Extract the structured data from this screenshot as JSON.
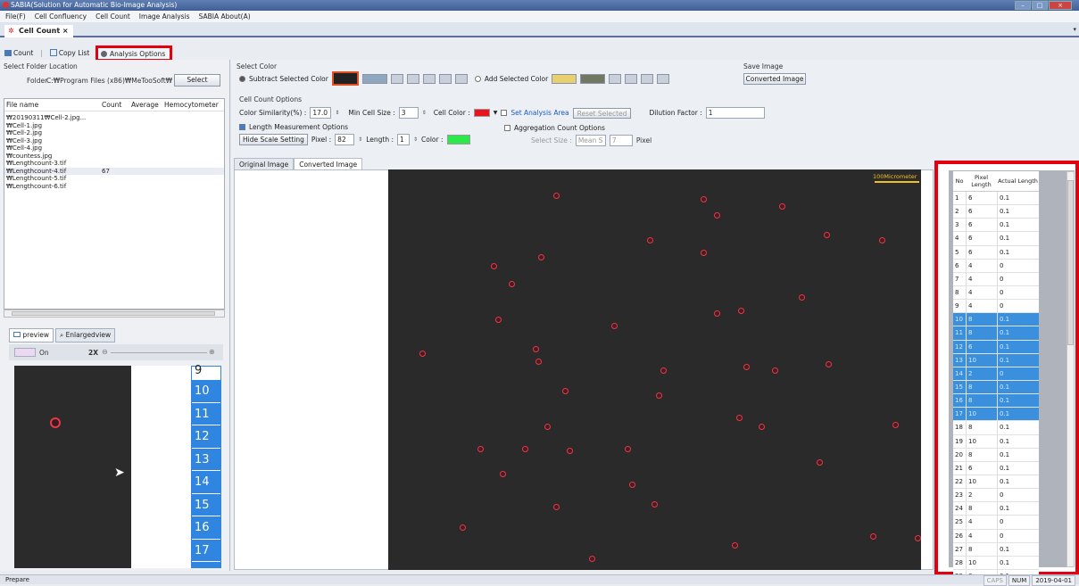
{
  "window": {
    "title": "SABIA(Solution for Automatic Bio-Image Analysis)"
  },
  "menu": [
    "File(F)",
    "Cell Confluency",
    "Cell Count",
    "Image Analysis",
    "SABIA About(A)"
  ],
  "doc_tab": "Cell Count ×",
  "toolbar": {
    "count": "Count",
    "copy_list": "Copy List",
    "analysis_options": "Analysis Options"
  },
  "folder": {
    "section": "Select Folder Location",
    "label": "Folder",
    "path": "C:₩Program Files (x86)₩MeTooSoft₩",
    "select": "Select"
  },
  "filelist": {
    "headers": [
      "File name",
      "Count",
      "Average",
      "Hemocytometer"
    ],
    "rows": [
      {
        "name": "₩20190311₩Cell-2.jpg...",
        "count": ""
      },
      {
        "name": "₩Cell-1.jpg",
        "count": ""
      },
      {
        "name": "₩Cell-2.jpg",
        "count": ""
      },
      {
        "name": "₩Cell-3.jpg",
        "count": ""
      },
      {
        "name": "₩Cell-4.jpg",
        "count": ""
      },
      {
        "name": "₩countess.jpg",
        "count": ""
      },
      {
        "name": "₩Lengthcount-3.tif",
        "count": ""
      },
      {
        "name": "₩Lengthcount-4.tif",
        "count": "67"
      },
      {
        "name": "₩Lengthcount-5.tif",
        "count": ""
      },
      {
        "name": "₩Lengthcount-6.tif",
        "count": ""
      }
    ]
  },
  "preview": {
    "tab_preview": "preview",
    "tab_enlarged": "Enlargedview",
    "on": "On",
    "zoom": "2X",
    "numbers": [
      "9",
      "10",
      "11",
      "12",
      "13",
      "14",
      "15",
      "16",
      "17"
    ]
  },
  "select_color": {
    "section": "Select Color",
    "subtract": "Subtract Selected Color",
    "add": "Add Selected Color",
    "save_section": "Save Image",
    "save_button": "Converted Image"
  },
  "cell_count_options": {
    "section": "Cell Count Options",
    "similarity_label": "Color Similarity(%) :",
    "similarity": "17.0",
    "min_size_label": "Min Cell Size :",
    "min_size": "3",
    "cell_color_label": "Cell Color :",
    "set_area": "Set Analysis Area",
    "reset": "Reset Selected",
    "dilution_label": "Dilution Factor :",
    "dilution": "1",
    "length_opts": "Length Measurement Options",
    "hide_scale": "Hide Scale Setting",
    "pixel_label": "Pixel :",
    "pixel": "82",
    "length_label": "Length :",
    "length": "1",
    "color_label": "Color :",
    "aggregation": "Aggregation Count Options",
    "select_size_label": "Select Size :",
    "select_size": "Mean S",
    "select_size_value": "7",
    "pixel_unit": "Pixel"
  },
  "image_tabs": [
    "Original Image",
    "Converted Image"
  ],
  "scale_label": "100Micrometer",
  "colors": {
    "accent_red": "#e3000f",
    "cell_red": "#e23a4a",
    "select_blue": "#3a90dd",
    "length_green": "#2de84a",
    "cell_color": "#e8141e"
  },
  "results": {
    "headers": [
      "No",
      "Pixel Length",
      "Actual Length"
    ],
    "rows": [
      [
        "1",
        "6",
        "0.1"
      ],
      [
        "2",
        "6",
        "0.1"
      ],
      [
        "3",
        "6",
        "0.1"
      ],
      [
        "4",
        "6",
        "0.1"
      ],
      [
        "5",
        "6",
        "0.1"
      ],
      [
        "6",
        "4",
        "0"
      ],
      [
        "7",
        "4",
        "0"
      ],
      [
        "8",
        "4",
        "0"
      ],
      [
        "9",
        "4",
        "0"
      ],
      [
        "10",
        "8",
        "0.1"
      ],
      [
        "11",
        "8",
        "0.1"
      ],
      [
        "12",
        "6",
        "0.1"
      ],
      [
        "13",
        "10",
        "0.1"
      ],
      [
        "14",
        "2",
        "0"
      ],
      [
        "15",
        "8",
        "0.1"
      ],
      [
        "16",
        "8",
        "0.1"
      ],
      [
        "17",
        "10",
        "0.1"
      ],
      [
        "18",
        "8",
        "0.1"
      ],
      [
        "19",
        "10",
        "0.1"
      ],
      [
        "20",
        "8",
        "0.1"
      ],
      [
        "21",
        "6",
        "0.1"
      ],
      [
        "22",
        "10",
        "0.1"
      ],
      [
        "23",
        "2",
        "0"
      ],
      [
        "24",
        "8",
        "0.1"
      ],
      [
        "25",
        "4",
        "0"
      ],
      [
        "26",
        "4",
        "0"
      ],
      [
        "27",
        "8",
        "0.1"
      ],
      [
        "28",
        "10",
        "0.1"
      ],
      [
        "29",
        "8",
        "0.1"
      ]
    ],
    "selected_from": 10,
    "selected_to": 17
  },
  "status": {
    "left": "Prepare",
    "caps": "CAPS",
    "num": "NUM",
    "date": "2019-04-01"
  }
}
